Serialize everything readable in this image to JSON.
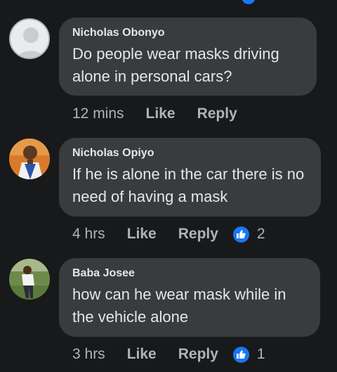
{
  "comments": [
    {
      "author": "Nicholas Obonyo",
      "text": "Do people wear masks  driving alone in personal cars?",
      "time": "12 mins",
      "like_label": "Like",
      "reply_label": "Reply",
      "reactions": null
    },
    {
      "author": "Nicholas Opiyo",
      "text": "If he is  alone in the car there is no need of having  a mask",
      "time": "4 hrs",
      "like_label": "Like",
      "reply_label": "Reply",
      "reactions": "2"
    },
    {
      "author": "Baba Josee",
      "text": "how can he wear mask while in the vehicle alone",
      "time": "3 hrs",
      "like_label": "Like",
      "reply_label": "Reply",
      "reactions": "1"
    }
  ],
  "colors": {
    "background": "#18191a",
    "bubble": "#3a3b3c",
    "text": "#e4e6eb",
    "meta": "#b0b3b8",
    "like_badge": "#1877f2"
  }
}
